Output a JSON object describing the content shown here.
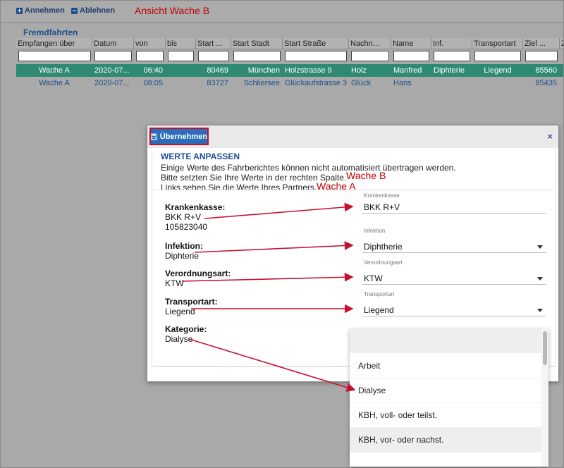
{
  "toolbar": {
    "accept_label": "Annehmen",
    "reject_label": "Ablehnen",
    "plus_glyph": "+",
    "minus_glyph": "−"
  },
  "annotations": {
    "view_label": "Ansicht Wache B",
    "wache_b": "Wache B",
    "wache_a": "Wache A"
  },
  "grid": {
    "title": "Fremdfahrten",
    "columns": [
      "Empfangen über",
      "Datum",
      "von",
      "bis",
      "Start ...",
      "Start Stadt",
      "Start Straße",
      "Nachn...",
      "Name",
      "Inf.",
      "Transportart",
      "Ziel ...",
      "Z"
    ],
    "rows": [
      {
        "empfangen": "Wache A",
        "datum": "2020-07...",
        "von": "06:40",
        "bis": "",
        "plz": "80469",
        "stadt": "München",
        "strasse": "Holzstrasse 9",
        "nachname": "Holz",
        "name": "Manfred",
        "inf": "Diphterie",
        "transport": "Liegend",
        "ziel": "85560"
      },
      {
        "empfangen": "Wache A",
        "datum": "2020-07...",
        "von": "08:05",
        "bis": "",
        "plz": "83727",
        "stadt": "Schliersee",
        "strasse": "Glückaufstrasse 3",
        "nachname": "Glück",
        "name": "Hans",
        "inf": "",
        "transport": "",
        "ziel": "85435"
      }
    ]
  },
  "dialog": {
    "save_label": "Übernehmen",
    "close_glyph": "×",
    "heading": "WERTE ANPASSEN",
    "line1": "Einige Werte des Fahrberichtes können nicht automatisiert übertragen werden.",
    "line2": "Bitte setzten Sie Ihre Werte in der rechten Spalte.",
    "line3": "Links sehen Sie die Werte Ihres Partners.",
    "fields": {
      "krankenkasse": {
        "label": "Krankenkasse:",
        "partner_value": "BKK R+V",
        "partner_value2": "105823040",
        "tiny": "Krankenkasse",
        "value": "BKK R+V"
      },
      "infektion": {
        "label": "Infektion:",
        "partner_value": "Diphterie",
        "tiny": "Infektion",
        "value": "Diphtherie"
      },
      "verordnung": {
        "label": "Verordnungsart:",
        "partner_value": "KTW",
        "tiny": "Verordnungsart",
        "value": "KTW"
      },
      "transport": {
        "label": "Transportart:",
        "partner_value": "Liegend",
        "tiny": "Transportart",
        "value": "Liegend"
      },
      "kategorie": {
        "label": "Kategorie:",
        "partner_value": "Dialyse"
      }
    }
  },
  "dropdown": {
    "options": [
      "",
      "Arbeit",
      "Dialyse",
      "KBH, voll- oder teilst.",
      "KBH, vor- oder nachst."
    ]
  },
  "colors": {
    "accent": "#2a6ebb",
    "selected_row": "#2f8a73",
    "annotation_red": "#c00000"
  }
}
